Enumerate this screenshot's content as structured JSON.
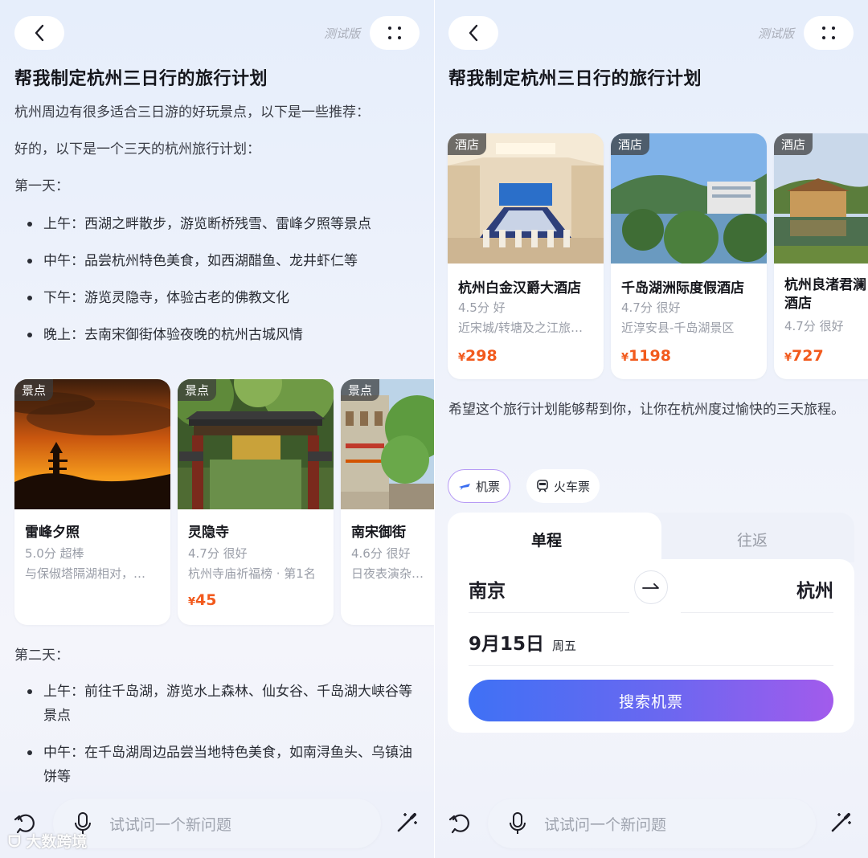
{
  "left": {
    "beta_label": "测试版",
    "title": "帮我制定杭州三日行的旅行计划",
    "intro": "杭州周边有很多适合三日游的好玩景点，以下是一些推荐：",
    "plan_intro": "好的，以下是一个三天的杭州旅行计划：",
    "day1_label": "第一天：",
    "day1_items": [
      "上午：西湖之畔散步，游览断桥残雪、雷峰夕照等景点",
      "中午：品尝杭州特色美食，如西湖醋鱼、龙井虾仁等",
      "下午：游览灵隐寺，体验古老的佛教文化",
      "晚上：去南宋御街体验夜晚的杭州古城风情"
    ],
    "attractions": [
      {
        "tag": "景点",
        "name": "雷峰夕照",
        "score": "5.0分 超棒",
        "desc": "与保俶塔隔湖相对，…",
        "price": ""
      },
      {
        "tag": "景点",
        "name": "灵隐寺",
        "score": "4.7分 很好",
        "desc": "杭州寺庙祈福榜 · 第1名",
        "price_symbol": "¥",
        "price": "45"
      },
      {
        "tag": "景点",
        "name": "南宋御街",
        "score": "4.6分 很好",
        "desc": "日夜表演杂剧、",
        "price": ""
      }
    ],
    "day2_label": "第二天：",
    "day2_items": [
      "上午：前往千岛湖，游览水上森林、仙女谷、千岛湖大峡谷等景点",
      "中午：在千岛湖周边品尝当地特色美食，如南浔鱼头、乌镇油饼等"
    ],
    "input_placeholder": "试试问一个新问题",
    "watermark": "大数跨境"
  },
  "right": {
    "beta_label": "测试版",
    "title": "帮我制定杭州三日行的旅行计划",
    "hotels": [
      {
        "tag": "酒店",
        "name": "杭州白金汉爵大酒店",
        "score": "4.5分 好",
        "desc": "近宋城/转塘及之江旅…",
        "price_symbol": "¥",
        "price": "298"
      },
      {
        "tag": "酒店",
        "name": "千岛湖洲际度假酒店",
        "score": "4.7分 很好",
        "desc": "近淳安县-千岛湖景区",
        "price_symbol": "¥",
        "price": "1198"
      },
      {
        "tag": "酒店",
        "name": "杭州良渚君澜酒店",
        "score": "4.7分 很好",
        "desc": "",
        "price_symbol": "¥",
        "price": "727"
      }
    ],
    "closing": "希望这个旅行计划能够帮到你，让你在杭州度过愉快的三天旅程。",
    "ticket_tabs": {
      "flight": "机票",
      "train": "火车票"
    },
    "flight": {
      "tab_oneway": "单程",
      "tab_roundtrip": "往返",
      "from": "南京",
      "to": "杭州",
      "date": "9月15日",
      "weekday": "周五",
      "search_label": "搜索机票"
    },
    "input_placeholder": "试试问一个新问题"
  },
  "colors": {
    "price": "#f25a1d",
    "accent_start": "#3f71f5",
    "accent_end": "#a25bec"
  }
}
